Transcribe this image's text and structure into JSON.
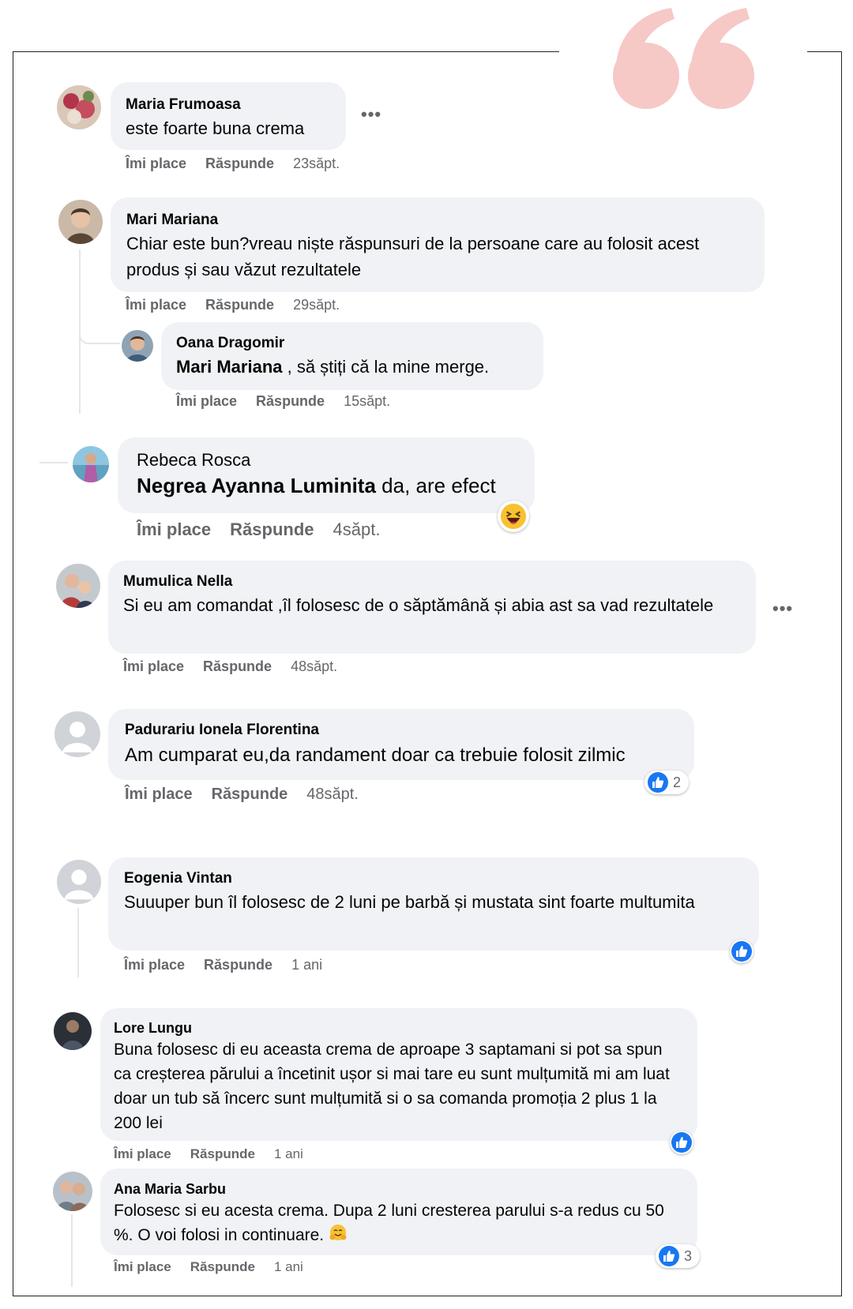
{
  "colors": {
    "bubble": "#f0f2f5",
    "accent": "#1877f2",
    "quote": "#f6c9c6",
    "muted": "#65676b"
  },
  "action_labels": {
    "like": "Îmi place",
    "reply": "Răspunde"
  },
  "comments": [
    {
      "author": "Maria Frumoasa",
      "text": "este foarte buna crema",
      "time": "23săpt."
    },
    {
      "author": "Mari Mariana",
      "text": "Chiar este bun?vreau niște răspunsuri de la persoane care au folosit acest produs și sau văzut rezultatele",
      "time": "29săpt."
    },
    {
      "author": "Oana Dragomir",
      "mention": "Mari Mariana",
      "text": " , să știți că la mine merge.",
      "time": "15săpt."
    },
    {
      "author": "Rebeca Rosca",
      "mention": "Negrea Ayanna Luminita",
      "text": " da, are efect",
      "time": "4săpt.",
      "reaction_icon": "laughing-emoji-icon"
    },
    {
      "author": "Mumulica Nella",
      "text": "Si eu am comandat ,îl folosesc de o săptămână și abia ast sa vad rezultatele",
      "time": "48săpt."
    },
    {
      "author": "Padurariu Ionela Florentina",
      "text": "Am cumparat eu,da randament doar ca trebuie folosit zilmic",
      "time": "48săpt.",
      "likes": "2"
    },
    {
      "author": "Eogenia Vintan",
      "text": "Suuuper bun îl folosesc de 2 luni pe barbă și mustata sint foarte multumita",
      "time": "1 ani"
    },
    {
      "author": "Lore Lungu",
      "text": "Buna folosesc di eu aceasta crema de aproape 3 saptamani si pot sa spun ca creșterea părului a încetinit ușor si mai tare eu sunt mulțumită mi am luat doar un tub să încerc sunt mulțumită si o sa comanda promoția 2 plus 1 la 200 lei",
      "time": "1 ani"
    },
    {
      "author": "Ana Maria Sarbu",
      "text": "Folosesc si eu acesta crema. Dupa 2 luni cresterea parului s-a redus cu 50 %. O voi folosi in continuare.",
      "time": "1 ani",
      "likes": "3",
      "emoji": "hugging-emoji-icon"
    }
  ]
}
